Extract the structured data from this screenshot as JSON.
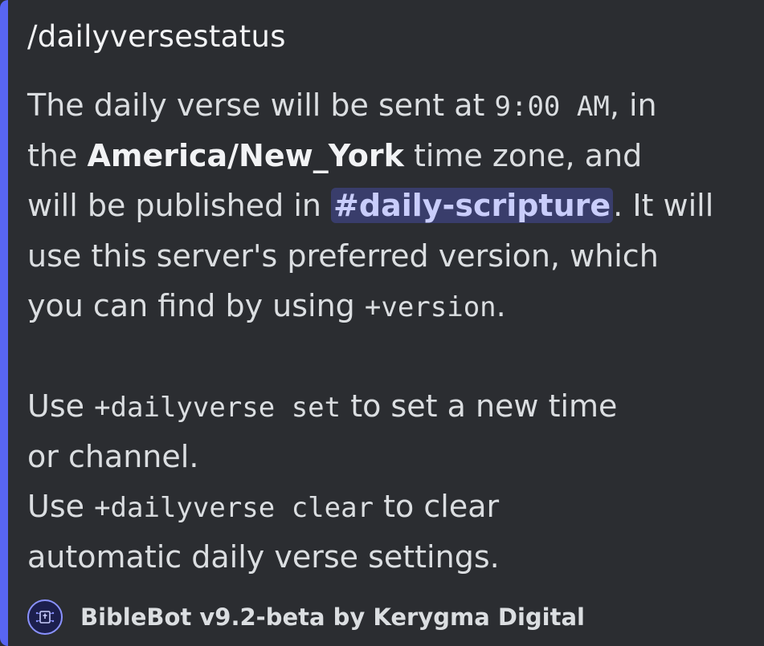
{
  "embed": {
    "accent_color": "#5865f2",
    "title": "/dailyversestatus",
    "lines": {
      "l1_a": "The daily verse will be sent at ",
      "l1_time": "9:00 AM",
      "l1_b": ", in",
      "l2_a": "the ",
      "l2_tz": "America/New_York",
      "l2_b": " time zone, and",
      "l3_a": "will be published in ",
      "l3_channel": "#daily-scripture",
      "l3_b": ". It will",
      "l4": "use this server's preferred version, which",
      "l5_a": "you can find by using ",
      "l5_cmd": "+version",
      "l5_b": ".",
      "l6_a": "Use ",
      "l6_cmd": "+dailyverse set",
      "l6_b": " to set a new time",
      "l7": "or channel.",
      "l8_a": "Use ",
      "l8_cmd": "+dailyverse clear",
      "l8_b": " to clear",
      "l9": "automatic daily verse settings."
    },
    "footer": {
      "icon": "biblebot-avatar-icon",
      "text": "BibleBot v9.2-beta by Kerygma Digital"
    }
  }
}
